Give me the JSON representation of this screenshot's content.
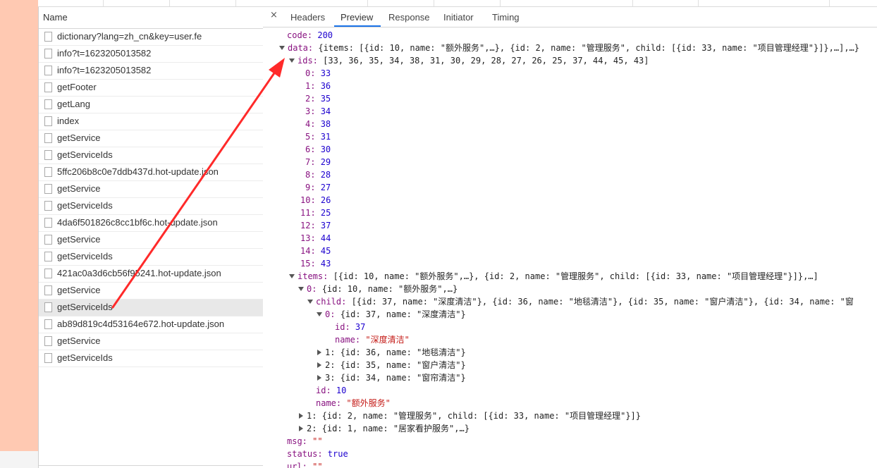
{
  "name_panel": {
    "header": "Name",
    "requests": [
      "dictionary?lang=zh_cn&key=user.fe",
      "info?t=1623205013582",
      "info?t=1623205013582",
      "getFooter",
      "getLang",
      "index",
      "getService",
      "getServiceIds",
      "5ffc206b8c0e7ddb437d.hot-update.json",
      "getService",
      "getServiceIds",
      "4da6f501826c8cc1bf6c.hot-update.json",
      "getService",
      "getServiceIds",
      "421ac0a3d6cb56f95241.hot-update.json",
      "getService",
      "getServiceIds",
      "ab89d819c4d53164e672.hot-update.json",
      "getService",
      "getServiceIds"
    ],
    "selected_index": 16
  },
  "tabs": {
    "close": "×",
    "items": [
      "Headers",
      "Preview",
      "Response",
      "Initiator",
      "Timing"
    ],
    "active": "Preview"
  },
  "preview": {
    "code_key": "code: ",
    "code_val": "200",
    "data_key": "data: ",
    "data_summary": "{items: [{id: 10, name: \"额外服务\",…}, {id: 2, name: \"管理服务\", child: [{id: 33, name: \"项目管理经理\"}]},…],…}",
    "ids_key": "ids: ",
    "ids_summary": "[33, 36, 35, 34, 38, 31, 30, 29, 28, 27, 26, 25, 37, 44, 45, 43]",
    "ids": [
      "33",
      "36",
      "35",
      "34",
      "38",
      "31",
      "30",
      "29",
      "28",
      "27",
      "26",
      "25",
      "37",
      "44",
      "45",
      "43"
    ],
    "items_key": "items: ",
    "items_summary": "[{id: 10, name: \"额外服务\",…}, {id: 2, name: \"管理服务\", child: [{id: 33, name: \"项目管理经理\"}]},…]",
    "item0_key": "0: ",
    "item0_summary": "{id: 10, name: \"额外服务\",…}",
    "child_key": "child: ",
    "child_summary": "[{id: 37, name: \"深度清洁\"}, {id: 36, name: \"地毯清洁\"}, {id: 35, name: \"窗户清洁\"}, {id: 34, name: \"窗",
    "child0_key": "0: ",
    "child0_summary": "{id: 37, name: \"深度清洁\"}",
    "child0_id_key": "id: ",
    "child0_id_val": "37",
    "child0_name_key": "name: ",
    "child0_name_val": "\"深度清洁\"",
    "child1": "1: {id: 36, name: \"地毯清洁\"}",
    "child2": "2: {id: 35, name: \"窗户清洁\"}",
    "child3": "3: {id: 34, name: \"窗帘清洁\"}",
    "item0_id_key": "id: ",
    "item0_id_val": "10",
    "item0_name_key": "name: ",
    "item0_name_val": "\"额外服务\"",
    "item1": "1: {id: 2, name: \"管理服务\", child: [{id: 33, name: \"项目管理经理\"}]}",
    "item2": "2: {id: 1, name: \"居家看护服务\",…}",
    "msg_key": "msg: ",
    "msg_val": "\"\"",
    "status_key": "status: ",
    "status_val": "true",
    "url_key": "url: ",
    "url_val": "\"\""
  },
  "colors": {
    "accent": "#1a73e8",
    "key": "#881280",
    "number": "#1c00cf",
    "string": "#c41a16",
    "arrow": "#ff2a2a",
    "left_strip": "#ffc9b2"
  }
}
